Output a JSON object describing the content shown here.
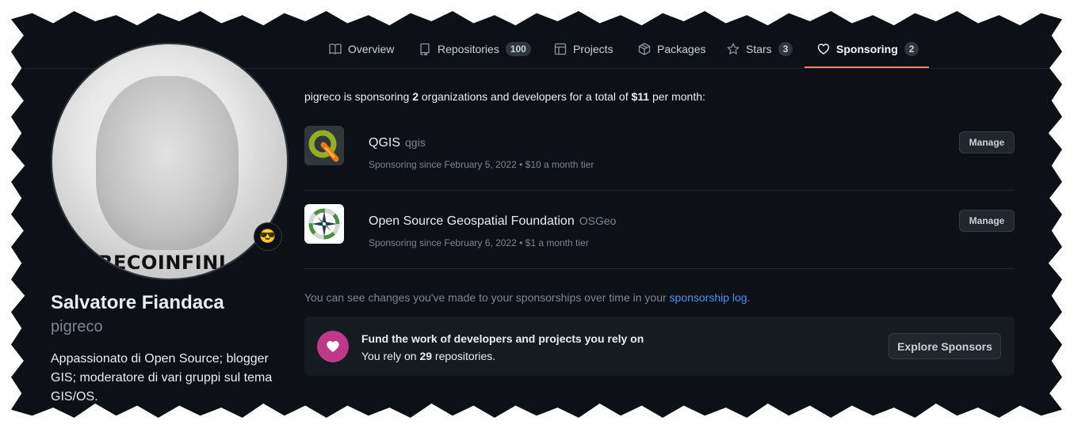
{
  "tabs": [
    {
      "label": "Overview",
      "icon": "book-icon",
      "count": ""
    },
    {
      "label": "Repositories",
      "icon": "repo-icon",
      "count": "100"
    },
    {
      "label": "Projects",
      "icon": "table-icon",
      "count": ""
    },
    {
      "label": "Packages",
      "icon": "package-icon",
      "count": ""
    },
    {
      "label": "Stars",
      "icon": "star-icon",
      "count": "3"
    },
    {
      "label": "Sponsoring",
      "icon": "heart-icon",
      "count": "2"
    }
  ],
  "active_tab": "Sponsoring",
  "accent_color": "#f78166",
  "profile": {
    "name": "Salvatore Fiandaca",
    "login": "pigreco",
    "bio": "Appassionato di Open Source; blogger GIS; moderatore di vari gruppi sul tema GIS/OS.",
    "avatar_text": "RECOINFINI",
    "status_emoji": "😎"
  },
  "summary": {
    "prefix": "pigreco is sponsoring ",
    "count": "2",
    "middle": " organizations and developers for a total of ",
    "amount": "$11",
    "suffix": " per month:"
  },
  "sponsorships": [
    {
      "name": "QGIS",
      "handle": "qgis",
      "meta": "Sponsoring since February 5, 2022 • $10 a month tier",
      "button": "Manage"
    },
    {
      "name": "Open Source Geospatial Foundation",
      "handle": "OSGeo",
      "meta": "Sponsoring since February 6, 2022 • $1 a month tier",
      "button": "Manage"
    }
  ],
  "log": {
    "text": "You can see changes you've made to your sponsorships over time in your ",
    "link": "sponsorship log",
    "end": "."
  },
  "fund": {
    "title": "Fund the work of developers and projects you rely on",
    "sub_prefix": "You rely on ",
    "sub_count": "29",
    "sub_suffix": " repositories.",
    "button": "Explore Sponsors",
    "heart_color": "#bf3989"
  }
}
